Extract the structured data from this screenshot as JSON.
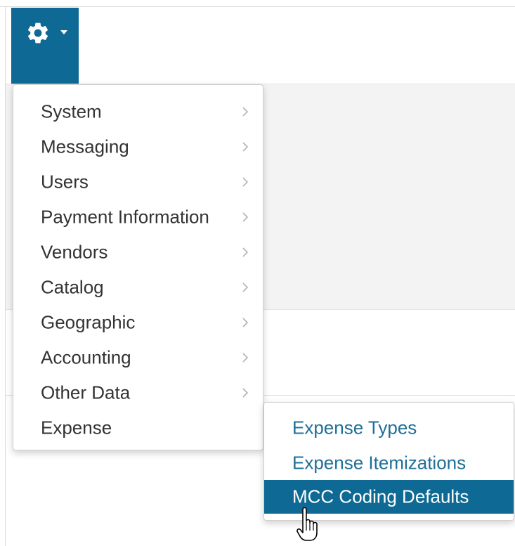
{
  "toolbar": {
    "settings_icon": "gear-icon",
    "dropdown_icon": "caret-down-icon",
    "accent_color": "#0e6a94"
  },
  "menu": {
    "items": [
      {
        "label": "System",
        "has_submenu": true
      },
      {
        "label": "Messaging",
        "has_submenu": true
      },
      {
        "label": "Users",
        "has_submenu": true
      },
      {
        "label": "Payment Information",
        "has_submenu": true
      },
      {
        "label": "Vendors",
        "has_submenu": true
      },
      {
        "label": "Catalog",
        "has_submenu": true
      },
      {
        "label": "Geographic",
        "has_submenu": true
      },
      {
        "label": "Accounting",
        "has_submenu": true
      },
      {
        "label": "Other Data",
        "has_submenu": true
      },
      {
        "label": "Expense",
        "has_submenu": false
      }
    ]
  },
  "submenu": {
    "items": [
      {
        "label": "Expense Types"
      },
      {
        "label": "Expense Itemizations"
      },
      {
        "label": "MCC Coding Defaults",
        "active": true
      }
    ],
    "link_color": "#1f6f97",
    "active_bg": "#0e6a94"
  }
}
